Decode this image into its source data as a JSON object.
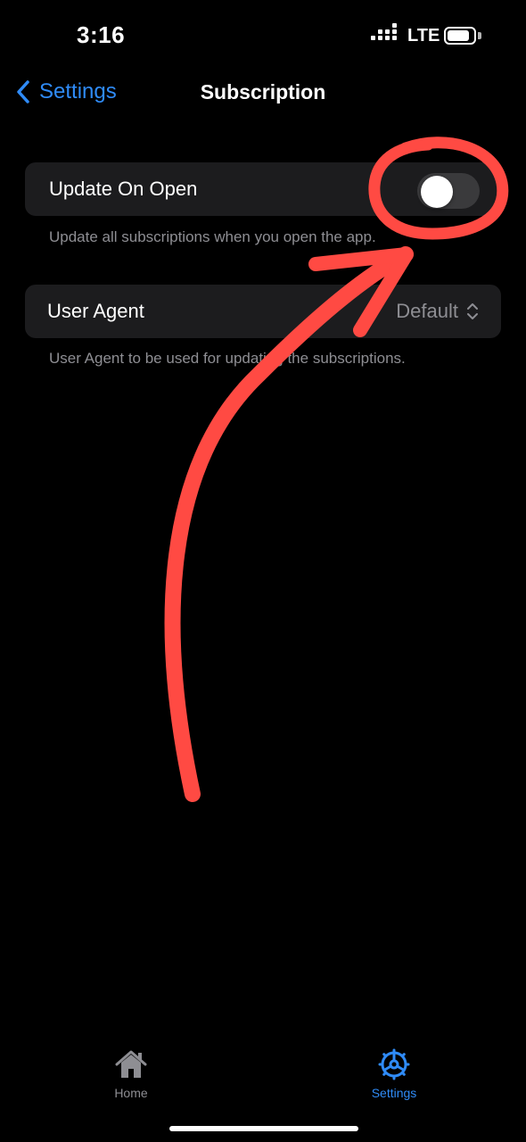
{
  "status_bar": {
    "time": "3:16",
    "network": "LTE",
    "icons": [
      "signal-dots-icon",
      "battery-icon"
    ]
  },
  "nav": {
    "back_label": "Settings",
    "title": "Subscription",
    "back_icon": "chevron-left-icon"
  },
  "settings": {
    "update_on_open": {
      "label": "Update On Open",
      "enabled": false,
      "footer": "Update all subscriptions when you open the app."
    },
    "user_agent": {
      "label": "User Agent",
      "value": "Default",
      "footer": "User Agent to be used for updating the subscriptions."
    }
  },
  "tab_bar": {
    "tabs": [
      {
        "label": "Home",
        "icon": "house-icon",
        "active": false
      },
      {
        "label": "Settings",
        "icon": "gear-icon",
        "active": true
      }
    ]
  },
  "annotation": {
    "color": "#ff4a43",
    "shapes": [
      "highlight-circle",
      "pointing-arrow"
    ]
  },
  "colors": {
    "accent": "#2f8bf7",
    "cell_background": "#1c1c1e",
    "secondary_text": "#8e8e93"
  }
}
